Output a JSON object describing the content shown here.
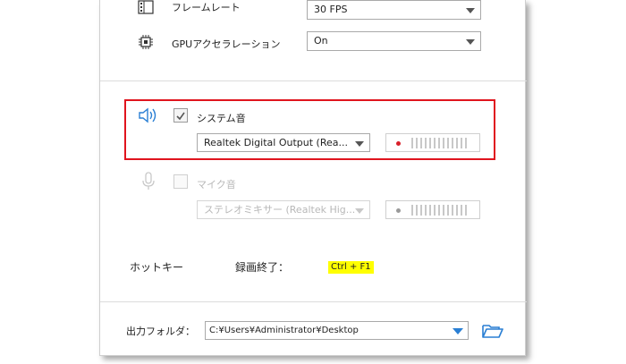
{
  "settings": {
    "framerate": {
      "label": "フレームレート",
      "value": "30 FPS"
    },
    "gpu": {
      "label": "GPUアクセラレーション",
      "value": "On"
    }
  },
  "audio": {
    "system": {
      "label": "システム音",
      "checked": true,
      "device": "Realtek Digital Output (Rea..."
    },
    "mic": {
      "label": "マイク音",
      "checked": false,
      "device": "ステレオミキサー (Realtek Hig..."
    }
  },
  "hotkey": {
    "label": "ホットキー",
    "action": "録画終了：",
    "value": "Ctrl + F1"
  },
  "output": {
    "label": "出力フォルダ：",
    "path": "C:¥Users¥Administrator¥Desktop"
  },
  "colors": {
    "highlight": "#e0141e",
    "accent": "#2a7fd4",
    "hotkey_bg": "#ffff00",
    "meter_dot": "#d9202a"
  }
}
